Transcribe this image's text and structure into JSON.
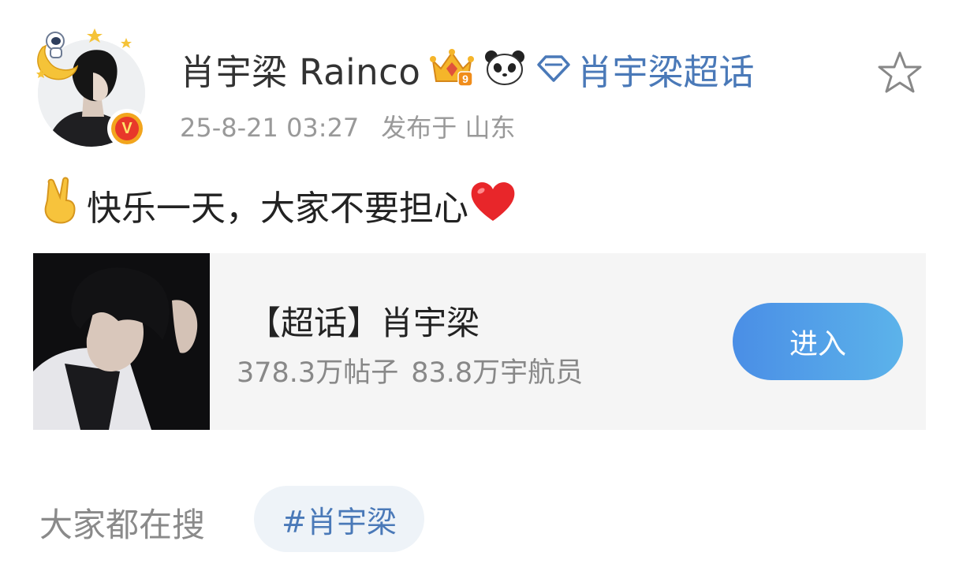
{
  "post": {
    "author": {
      "name": "肖宇梁 Rainco",
      "verified_badge": "V"
    },
    "topic_link": "肖宇梁超话",
    "timestamp": "25-8-21 03:27",
    "location": "发布于 山东",
    "text": "快乐一天，大家不要担心"
  },
  "icons": {
    "avatar_decor": "astronaut-moon-stars-icon",
    "crown": "crown-level-9-icon",
    "panda": "panda-icon",
    "topic": "diamond-icon",
    "favorite": "star-outline-icon",
    "emoji_start": "victory-hand-emoji",
    "emoji_end": "red-heart-emoji"
  },
  "crown_level": "9",
  "card": {
    "title": "【超话】肖宇梁",
    "posts": "378.3万帖子",
    "members": "83.8万宇航员",
    "button": "进入"
  },
  "search": {
    "label": "大家都在搜",
    "hashtag": "#肖宇梁"
  },
  "colors": {
    "link_blue": "#4a79b8",
    "button_gradient_start": "#4a8ee6",
    "button_gradient_end": "#5cb3ea",
    "card_bg": "#f5f5f5",
    "chip_bg": "#eef3f8",
    "verified_red": "#e8382a",
    "verified_gold": "#f2a51d"
  }
}
